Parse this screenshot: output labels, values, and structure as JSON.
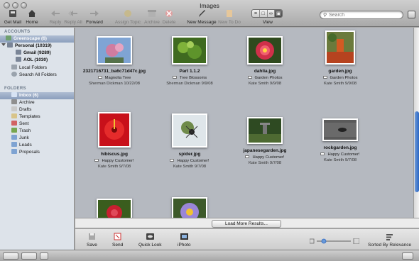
{
  "window": {
    "title": "Images"
  },
  "toolbar": {
    "get_mail": "Get Mail",
    "home": "Home",
    "reply": "Reply",
    "reply_all": "Reply All",
    "forward": "Forward",
    "assign_topic": "Assign Topic",
    "archive": "Archive",
    "delete": "Delete",
    "new_message": "New Message",
    "new_todo": "New To Do",
    "view": "View"
  },
  "search": {
    "placeholder": "Search",
    "value": ""
  },
  "sidebar": {
    "accounts_header": "ACCOUNTS",
    "accounts": [
      {
        "label": "Greenscape (6)",
        "selected": true
      },
      {
        "label": "Personal (10319)"
      },
      {
        "label": "Gmail (9289)"
      },
      {
        "label": "AOL (1030)"
      },
      {
        "label": "Local Folders"
      },
      {
        "label": "Search All Folders"
      }
    ],
    "folders_header": "FOLDERS",
    "folders": [
      {
        "label": "Inbox (6)",
        "selected": true
      },
      {
        "label": "Archive"
      },
      {
        "label": "Drafts"
      },
      {
        "label": "Templates"
      },
      {
        "label": "Sent"
      },
      {
        "label": "Trash"
      },
      {
        "label": "Junk"
      },
      {
        "label": "Leads"
      },
      {
        "label": "Proposals"
      }
    ]
  },
  "results": [
    {
      "name": "2321716731_ba6c71d47c.jpg",
      "folder": "Magnolia Tree",
      "author": "Sherman Dickman",
      "date": "10/22/08"
    },
    {
      "name": "Part 1.1.2",
      "folder": "Tree Blossoms",
      "author": "Sherman Dickman",
      "date": "9/9/08"
    },
    {
      "name": "dahlia.jpg",
      "folder": "Garden Photos",
      "author": "Kate Smith",
      "date": "9/9/08"
    },
    {
      "name": "garden.jpg",
      "folder": "Garden Photos",
      "author": "Kate Smith",
      "date": "9/9/08"
    },
    {
      "name": "hibiscus.jpg",
      "folder": "Happy Customer!",
      "author": "Kate Smith",
      "date": "9/7/08"
    },
    {
      "name": "spider.jpg",
      "folder": "Happy Customer!",
      "author": "Kate Smith",
      "date": "9/7/08"
    },
    {
      "name": "japanesegarden.jpg",
      "folder": "Happy Customer!",
      "author": "Kate Smith",
      "date": "9/7/08"
    },
    {
      "name": "rockgarden.jpg",
      "folder": "Happy Customer!",
      "author": "Kate Smith",
      "date": "9/7/08"
    }
  ],
  "load_more": "Load More Results...",
  "actions": {
    "save": "Save",
    "send": "Send",
    "quick_look": "Quick Look",
    "iphoto": "iPhoto",
    "sorted_by": "Sorted By Relevance"
  },
  "colors": {
    "selection": "#8b9fbd",
    "content_bg": "#b5b9c0",
    "scroll_thumb": "#2b66c2"
  }
}
